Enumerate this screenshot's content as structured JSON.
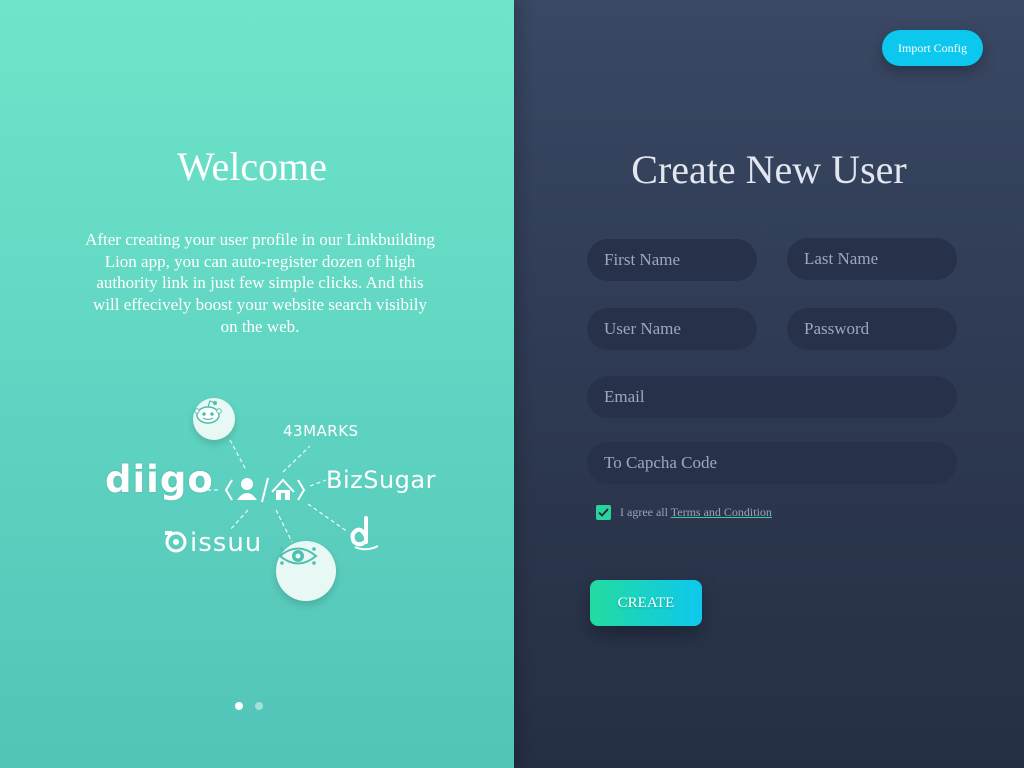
{
  "left": {
    "title": "Welcome",
    "description": "After creating your user profile in our Linkbuilding Lion app, you can auto-register dozen of high authority link in just few simple clicks. And this will effecively boost your website search visibily on the web.",
    "brands": {
      "diigo": "diigo",
      "bizsugar": "BizSugar",
      "marks43": "43MARKS",
      "issuu": "issuu"
    },
    "pagination": {
      "total": 2,
      "active": 1
    }
  },
  "right": {
    "import_label": "Import Config",
    "title": "Create New User",
    "fields": {
      "first_name": "First Name",
      "last_name": "Last Name",
      "user_name": "User Name",
      "password": "Password",
      "email": "Email",
      "capcha": "To Capcha Code"
    },
    "agree_text": "I agree all",
    "terms_label": "Terms and Condition",
    "agree_checked": true,
    "create_label": "CREATE"
  },
  "colors": {
    "accent_cyan": "#0cc7ee",
    "accent_green": "#22dba0",
    "left_bg": "#62d8c5",
    "right_bg": "#2f3b54"
  }
}
